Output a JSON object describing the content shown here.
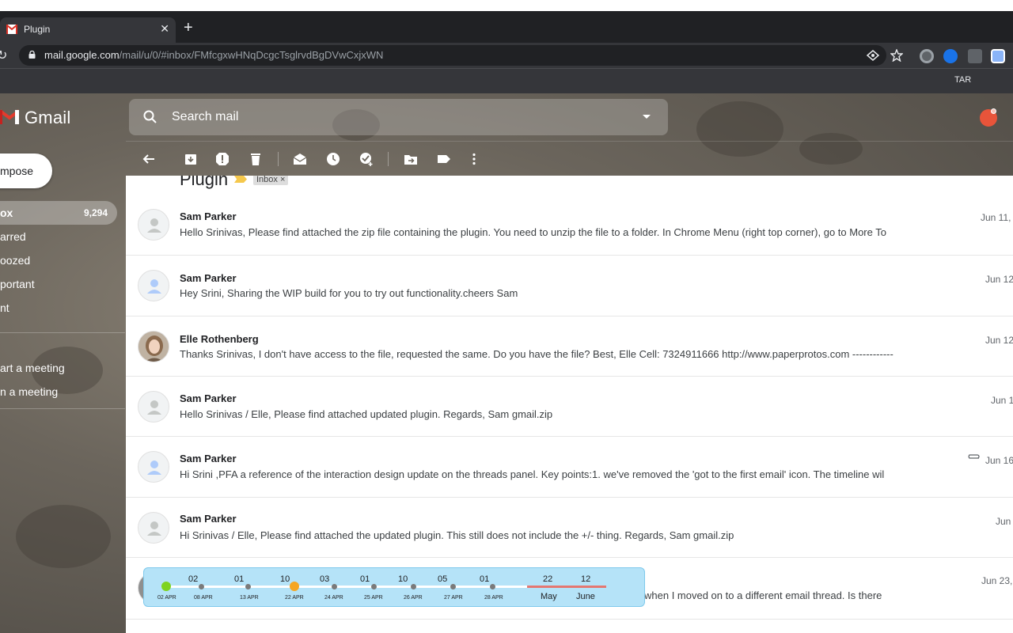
{
  "browser": {
    "tab_title": "Plugin",
    "url_host": "mail.google.com",
    "url_path": "/mail/u/0/#inbox/FMfcgxwHNqDcgcTsglrvdBgDVwCxjxWN",
    "bookmark_text": "TAR"
  },
  "header": {
    "app_name": "Gmail",
    "search_placeholder": "Search mail"
  },
  "sidebar": {
    "compose_label": "mpose",
    "items": [
      {
        "label": "ox",
        "count": "9,294"
      },
      {
        "label": "arred"
      },
      {
        "label": "oozed"
      },
      {
        "label": "portant"
      },
      {
        "label": "nt"
      }
    ],
    "meet": [
      {
        "label": "art a meeting"
      },
      {
        "label": "n a meeting"
      }
    ]
  },
  "thread": {
    "subject": "Plugin",
    "label_chip": "Inbox",
    "label_chip_close": "×"
  },
  "emails": [
    {
      "sender": "Sam Parker",
      "snippet": "Hello Srinivas, Please find attached the zip file containing the plugin. You need to unzip the file to a folder. In Chrome Menu (right top corner), go to More To",
      "date": "Jun 11,",
      "avatar": "default"
    },
    {
      "sender": "Sam Parker",
      "snippet": "Hey Srini,  Sharing the WIP build for you to try out functionality.cheers Sam",
      "date": "Jun 12",
      "avatar": "default-blue"
    },
    {
      "sender": "Elle Rothenberg",
      "snippet": "Thanks Srinivas, I don't have access to the file, requested the same. Do you have the file? Best, Elle    Cell: 7324911666 http://www.paperprotos.com ------------",
      "date": "Jun 12",
      "avatar": "photo"
    },
    {
      "sender": "Sam Parker",
      "snippet": "Hello Srinivas / Elle,   Please find attached updated plugin. Regards, Sam    gmail.zip",
      "date": "Jun 1",
      "avatar": "default"
    },
    {
      "sender": "Sam Parker",
      "snippet": "Hi Srini ,PFA a reference of the interaction design update on the threads panel. Key points:1. we've removed the 'got to the first email' icon. The timeline wil",
      "date": "Jun 16",
      "avatar": "default-blue",
      "attachment": true
    },
    {
      "sender": "Sam Parker",
      "snippet": "Hi Srinivas / Elle,       Please find attached the updated plugin. This still does not include the +/- thing. Regards, Sam    gmail.zip",
      "date": "Jun",
      "avatar": "default"
    },
    {
      "sender": "",
      "snippet": "when I moved on to a different email thread. Is there",
      "date": "Jun 23,",
      "avatar": "photo"
    }
  ],
  "timeline": {
    "points": [
      {
        "num": "02",
        "date": "02 APR",
        "state": "start"
      },
      {
        "num": "",
        "date": "08 APR",
        "state": "normal"
      },
      {
        "num": "01",
        "date": "13 APR",
        "state": "normal"
      },
      {
        "num": "10",
        "date": "22 APR",
        "state": "current"
      },
      {
        "num": "03",
        "date": "24 APR",
        "state": "normal"
      },
      {
        "num": "01",
        "date": "25 APR",
        "state": "normal"
      },
      {
        "num": "10",
        "date": "26 APR",
        "state": "normal"
      },
      {
        "num": "05",
        "date": "27 APR",
        "state": "normal"
      },
      {
        "num": "01",
        "date": "28 APR",
        "state": "normal"
      }
    ],
    "months": [
      {
        "num": "22",
        "label": "May"
      },
      {
        "num": "12",
        "label": "June"
      }
    ],
    "colors": {
      "start": "#7ed321",
      "current": "#f5a623",
      "normal": "#7a7a7a",
      "month_bar": "#e47771"
    }
  }
}
